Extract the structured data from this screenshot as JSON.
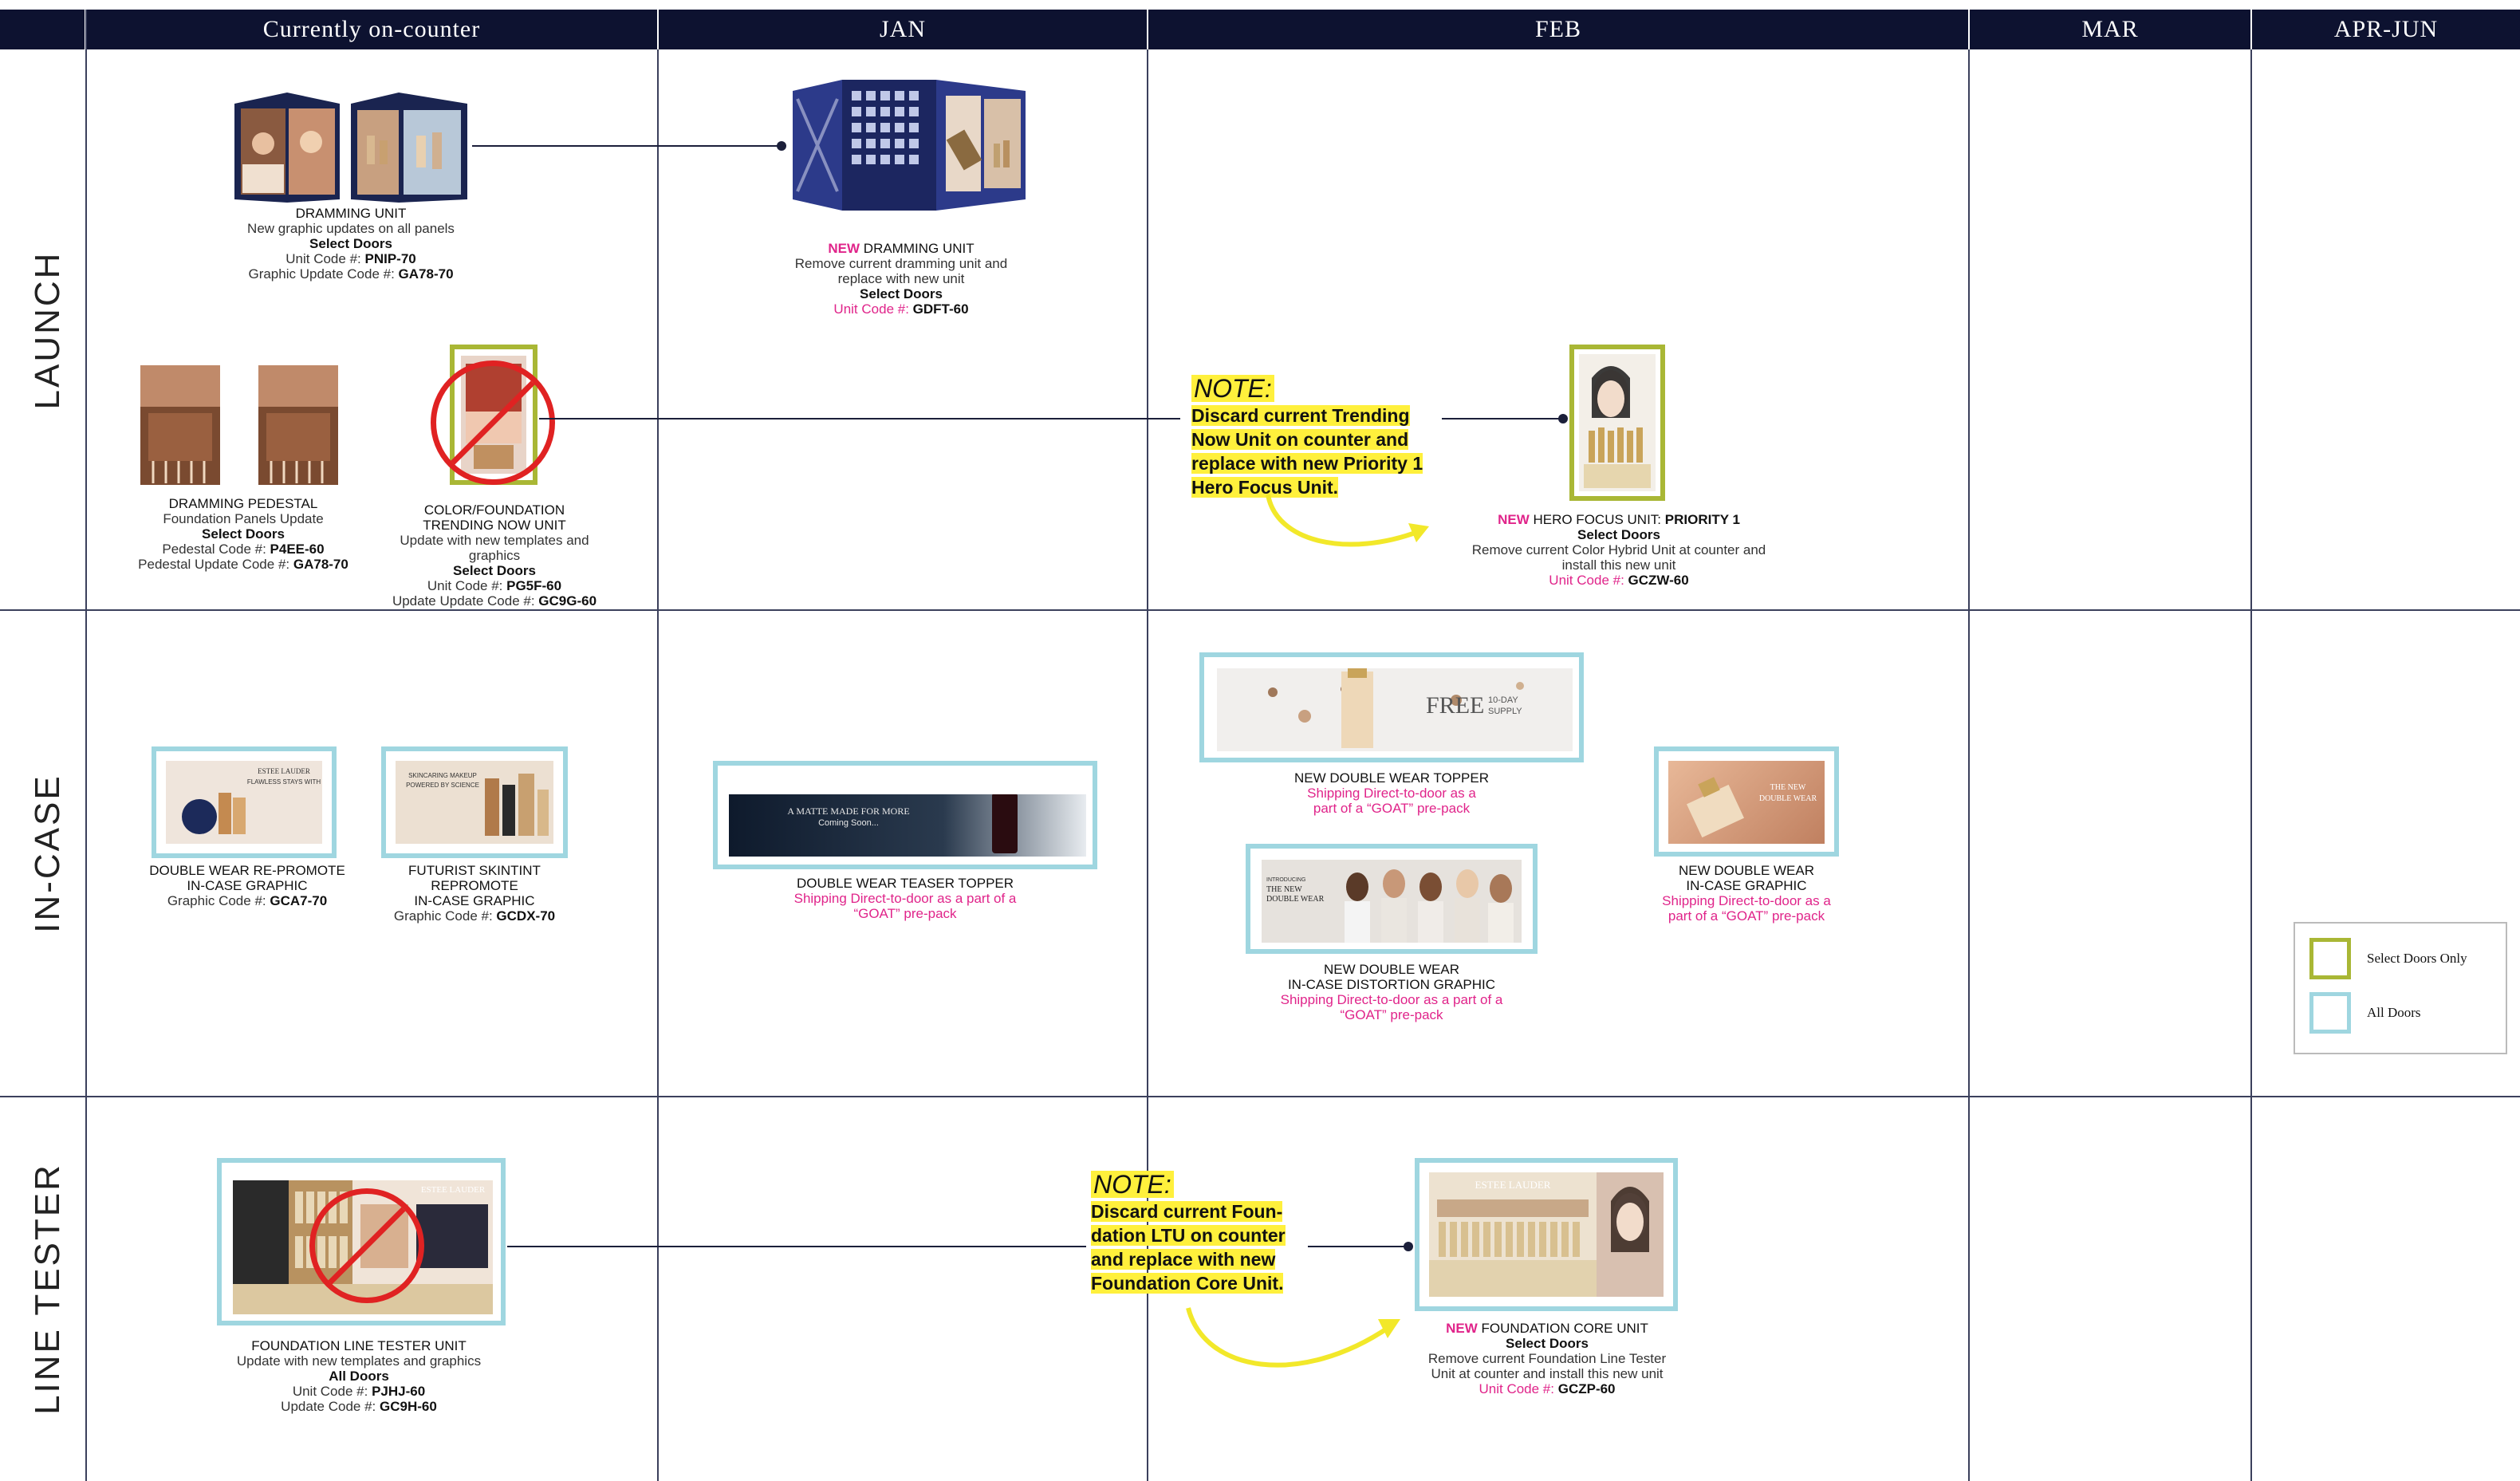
{
  "headers": [
    "Currently on-counter",
    "JAN",
    "FEB",
    "MAR",
    "APR-JUN"
  ],
  "rows": [
    "LAUNCH",
    "IN-CASE",
    "LINE TESTER"
  ],
  "colors": {
    "header_bg": "#0d1230",
    "select_doors": "#a9b735",
    "all_doors": "#9fd6e0",
    "accent_pink": "#e0248a",
    "highlight": "#fff03c"
  },
  "launch": {
    "dramming_unit": {
      "title": "DRAMMING UNIT",
      "desc": "New graphic updates on all panels",
      "doors": "Select Doors",
      "unit_label": "Unit Code #:",
      "unit_code": "PNIP-70",
      "graphic_label": "Graphic Update Code #:",
      "graphic_code": "GA78-70"
    },
    "new_dramming_unit": {
      "new": "NEW",
      "title": " DRAMMING UNIT",
      "desc1": "Remove current dramming unit and",
      "desc2": "replace with new unit",
      "doors": "Select Doors",
      "code_label": "Unit Code #:",
      "code": "GDFT-60"
    },
    "dramming_pedestal": {
      "title": "DRAMMING PEDESTAL",
      "desc": "Foundation Panels Update",
      "doors": "Select Doors",
      "ped_label": "Pedestal Code #:",
      "ped_code": "P4EE-60",
      "upd_label": "Pedestal Update Code #:",
      "upd_code": "GA78-70"
    },
    "trending_now": {
      "title1": "COLOR/FOUNDATION",
      "title2": "TRENDING NOW UNIT",
      "desc1": "Update with new templates and",
      "desc2": "graphics",
      "doors": "Select Doors",
      "unit_label": "Unit Code #:",
      "unit_code": "PG5F-60",
      "upd_label": "Update Update Code #:",
      "upd_code": "GC9G-60"
    },
    "note": {
      "label": "NOTE:",
      "lines": [
        "Discard current Trending",
        "Now Unit on counter and",
        "replace with new Priority 1",
        "Hero Focus Unit."
      ]
    },
    "hero_focus": {
      "new": "NEW",
      "title": " HERO FOCUS UNIT: ",
      "priority": "PRIORITY 1",
      "doors": "Select Doors",
      "desc1": "Remove current Color Hybrid Unit at counter and",
      "desc2": "install this new unit",
      "code_label": "Unit Code #:",
      "code": "GCZW-60"
    }
  },
  "incase": {
    "dw_repromote": {
      "title1": "DOUBLE WEAR RE-PROMOTE",
      "title2": "IN-CASE GRAPHIC",
      "code_label": "Graphic Code #:",
      "code": "GCA7-70",
      "img_text1": "ESTEE LAUDER",
      "img_text2": "FLAWLESS STAYS WITH"
    },
    "futurist": {
      "title1": "FUTURIST SKINTINT",
      "title2": "REPROMOTE",
      "title3": "IN-CASE GRAPHIC",
      "code_label": "Graphic Code #:",
      "code": "GCDX-70",
      "img_text1": "SKINCARING MAKEUP",
      "img_text2": "POWERED BY SCIENCE"
    },
    "teaser": {
      "title": "DOUBLE WEAR TEASER TOPPER",
      "ship1": "Shipping Direct-to-door as a part of a",
      "ship2": "“GOAT” pre-pack",
      "img_text1": "A MATTE MADE FOR MORE",
      "img_text2": "Coming Soon..."
    },
    "dw_topper": {
      "title": "NEW DOUBLE WEAR TOPPER",
      "ship1": "Shipping Direct-to-door as a",
      "ship2": "part of a “GOAT” pre-pack",
      "free": "FREE",
      "supply1": "10-DAY",
      "supply2": "SUPPLY"
    },
    "dw_distortion": {
      "title1": "NEW DOUBLE WEAR",
      "title2": "IN-CASE DISTORTION GRAPHIC",
      "ship1": "Shipping Direct-to-door as a part of a",
      "ship2": "“GOAT” pre-pack",
      "img_text1": "INTRODUCING",
      "img_text2": "THE NEW",
      "img_text3": "DOUBLE WEAR"
    },
    "dw_incase": {
      "title1": "NEW DOUBLE WEAR",
      "title2": "IN-CASE GRAPHIC",
      "ship1": "Shipping Direct-to-door as a",
      "ship2": "part of a “GOAT” pre-pack",
      "img_text1": "THE NEW",
      "img_text2": "DOUBLE WEAR"
    }
  },
  "legend": {
    "select": "Select Doors Only",
    "all": "All Doors"
  },
  "tester": {
    "fltu": {
      "title": "FOUNDATION LINE TESTER UNIT",
      "desc": "Update with new templates and graphics",
      "doors": "All Doors",
      "unit_label": "Unit Code #:",
      "unit_code": "PJHJ-60",
      "upd_label": "Update Code #:",
      "upd_code": "GC9H-60",
      "img_brand": "ESTEE LAUDER"
    },
    "note": {
      "label": "NOTE:",
      "lines": [
        "Discard current Foun-",
        "dation LTU on counter",
        "and replace with new",
        "Foundation Core Unit."
      ]
    },
    "core": {
      "new": "NEW",
      "title": " FOUNDATION CORE UNIT",
      "doors": "Select Doors",
      "desc1": "Remove current Foundation Line Tester",
      "desc2": "Unit at counter and install this new unit",
      "code_label": "Unit Code #:",
      "code": "GCZP-60",
      "img_brand": "ESTEE LAUDER"
    }
  }
}
